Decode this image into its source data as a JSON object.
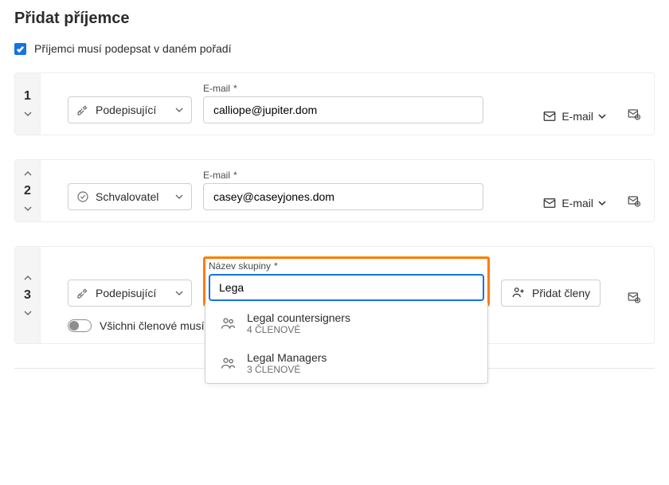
{
  "title": "Přidat příjemce",
  "order_checkbox_label": "Příjemci musí podepsat v daném pořadí",
  "email_field_label": "E-mail",
  "group_field_label": "Název skupiny",
  "required_asterisk": "*",
  "delivery_label": "E-mail",
  "add_members_label": "Přidat členy",
  "toggle_all_sign_label": "Všichni členové musí m",
  "recipients": [
    {
      "order": "1",
      "role": "Podepisující",
      "email": "calliope@jupiter.dom"
    },
    {
      "order": "2",
      "role": "Schvalovatel",
      "email": "casey@caseyjones.dom"
    },
    {
      "order": "3",
      "role": "Podepisující",
      "group_query": "Lega"
    }
  ],
  "group_suggestions": [
    {
      "name": "Legal countersigners",
      "meta": "4 ČLENOVÉ"
    },
    {
      "name": "Legal Managers",
      "meta": "3 ČLENOVÉ"
    }
  ]
}
